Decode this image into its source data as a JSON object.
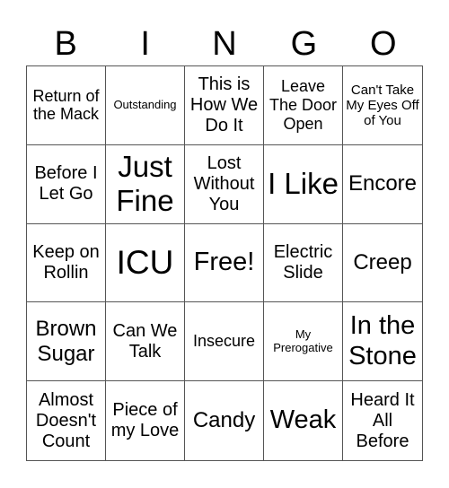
{
  "header": {
    "letters": [
      "B",
      "I",
      "N",
      "G",
      "O"
    ]
  },
  "cells": [
    [
      "Return of the Mack",
      "Outstanding",
      "This is How We Do It",
      "Leave The Door Open",
      "Can't Take My Eyes Off of You"
    ],
    [
      "Before I Let Go",
      "Just Fine",
      "Lost Without You",
      "I Like",
      "Encore"
    ],
    [
      "Keep on Rollin",
      "ICU",
      "Free!",
      "Electric Slide",
      "Creep"
    ],
    [
      "Brown Sugar",
      "Can We Talk",
      "Insecure",
      "My Prerogative",
      "In the Stone"
    ],
    [
      "Almost Doesn't Count",
      "Piece of my Love",
      "Candy",
      "Weak",
      "Heard It All Before"
    ]
  ]
}
